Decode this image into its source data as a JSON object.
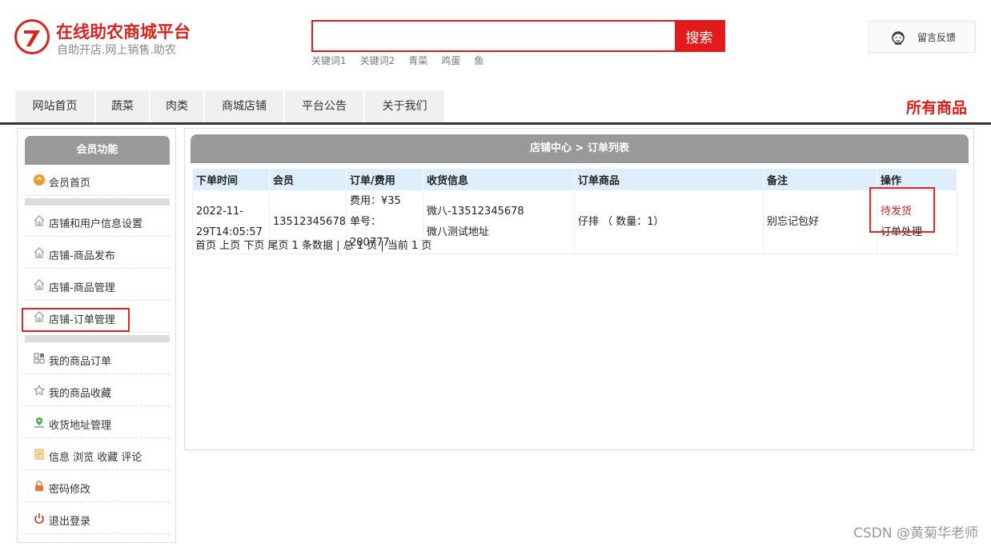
{
  "header": {
    "title": "在线助农商城平台",
    "subtitle": "自助开店.网上销售.助农",
    "search_placeholder": "",
    "search_button": "搜索",
    "keywords": [
      "关键词1",
      "关键词2",
      "青菜",
      "鸡蛋",
      "鱼"
    ],
    "feedback_label": "留言反馈"
  },
  "nav": {
    "tabs": [
      "网站首页",
      "蔬菜",
      "肉类",
      "商城店铺",
      "平台公告",
      "关于我们"
    ],
    "all_products": "所有商品"
  },
  "sidebar": {
    "title": "会员功能",
    "home": "会员首页",
    "shop_items": [
      "店铺和用户信息设置",
      "店铺-商品发布",
      "店铺-商品管理",
      "店铺-订单管理"
    ],
    "user_items": [
      "我的商品订单",
      "我的商品收藏",
      "收货地址管理",
      "信息 浏览 收藏 评论",
      "密码修改",
      "退出登录"
    ]
  },
  "main": {
    "breadcrumb": "店铺中心 > 订单列表",
    "columns": [
      "下单时间",
      "会员",
      "订单/费用",
      "收货信息",
      "订单商品",
      "备注",
      "操作"
    ],
    "order": {
      "time_line1": "2022-11-",
      "time_line2": "29T14:05:57",
      "member": "13512345678",
      "fee": "费用：¥35",
      "order_no": "单号：200777",
      "receiver": "微八-13512345678",
      "address": "微八测试地址",
      "product": "仔排 （ 数量：1）",
      "note": "别忘记包好",
      "status": "待发货",
      "action": "订单处理"
    },
    "pager": {
      "first": "首页",
      "prev": "上页",
      "next": "下页",
      "last": "尾页",
      "summary": "1 条数据 | 总 1 页 | 当前 1 页"
    }
  },
  "watermark": "CSDN @黄菊华老师",
  "colors": {
    "brand_red": "#e31a1a",
    "header_gray": "#999999",
    "table_header": "#ddeefc"
  }
}
